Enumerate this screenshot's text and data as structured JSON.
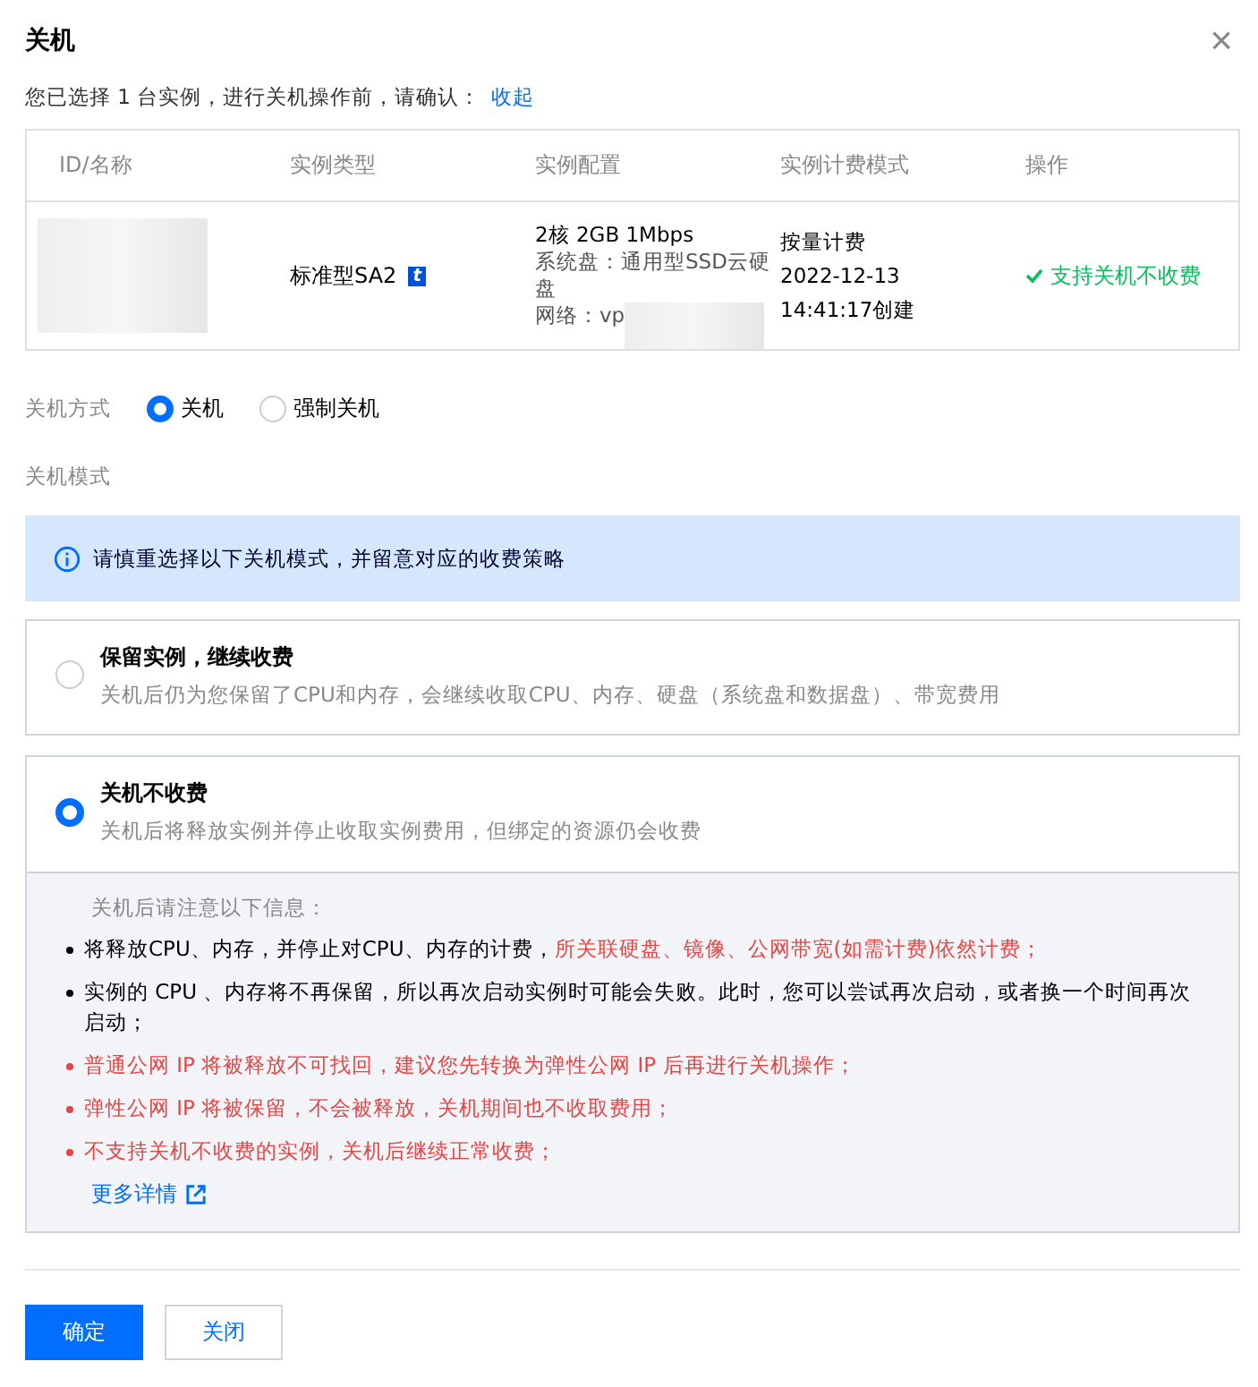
{
  "dialog": {
    "title": "关机",
    "close_label": "×"
  },
  "summary": {
    "text": "您已选择 1 台实例，进行关机操作前，请确认：",
    "link": "收起"
  },
  "table": {
    "columns": [
      "ID/名称",
      "实例类型",
      "实例配置",
      "实例计费模式",
      "操作"
    ],
    "rows": [
      {
        "instance_type": "标准型SA2",
        "type_badge": "t",
        "config": {
          "spec": "2核 2GB 1Mbps",
          "system_disk": "系统盘：通用型SSD云硬盘",
          "network": "网络：vp"
        },
        "billing": [
          "按量计费",
          "2022-12-13",
          "14:41:17创建"
        ],
        "action": "支持关机不收费"
      }
    ]
  },
  "shutdown_method": {
    "label": "关机方式",
    "options": [
      {
        "label": "关机",
        "selected": true
      },
      {
        "label": "强制关机",
        "selected": false
      }
    ]
  },
  "shutdown_mode": {
    "label": "关机模式",
    "alert": "请慎重选择以下关机模式，并留意对应的收费策略",
    "options": [
      {
        "title": "保留实例，继续收费",
        "description": "关机后仍为您保留了CPU和内存，会继续收取CPU、内存、硬盘（系统盘和数据盘）、带宽费用",
        "selected": false
      },
      {
        "title": "关机不收费",
        "description": "关机后将释放实例并停止收取实例费用，但绑定的资源仍会收费",
        "selected": true,
        "notes_title": "关机后请注意以下信息：",
        "notes": [
          {
            "warning": false,
            "parts": [
              {
                "text": "将释放CPU、内存，并停止对CPU、内存的计费，",
                "warning": false
              },
              {
                "text": "所关联硬盘、镜像、公网带宽(如需计费)依然计费；",
                "warning": true
              }
            ]
          },
          {
            "warning": false,
            "parts": [
              {
                "text": "实例的 CPU 、内存将不再保留，所以再次启动实例时可能会失败。此时，您可以尝试再次启动，或者换一个时间再次启动；",
                "warning": false
              }
            ]
          },
          {
            "warning": true,
            "parts": [
              {
                "text": "普通公网 IP 将被释放不可找回，建议您先转换为弹性公网 IP 后再进行关机操作；",
                "warning": true
              }
            ]
          },
          {
            "warning": true,
            "parts": [
              {
                "text": "弹性公网 IP 将被保留，不会被释放，关机期间也不收取费用；",
                "warning": true
              }
            ]
          },
          {
            "warning": true,
            "parts": [
              {
                "text": "不支持关机不收费的实例，关机后继续正常收费；",
                "warning": true
              }
            ]
          }
        ],
        "more_link": "更多详情"
      }
    ]
  },
  "footer": {
    "buttons": [
      {
        "label": "确定",
        "kind": "primary"
      },
      {
        "label": "关闭",
        "kind": "secondary"
      }
    ]
  }
}
